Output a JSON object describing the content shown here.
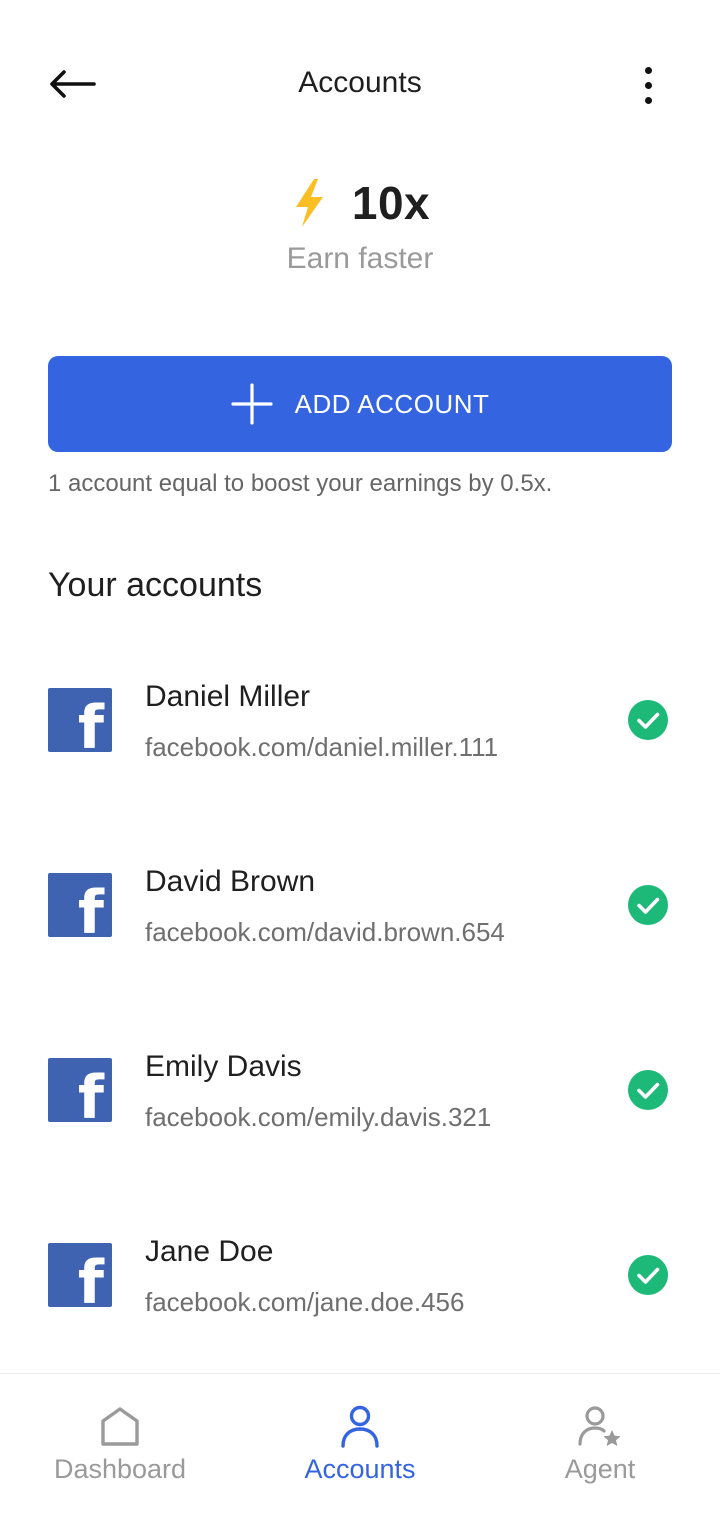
{
  "header": {
    "title": "Accounts",
    "back_icon": "arrow-left-icon",
    "menu_icon": "more-vertical-icon"
  },
  "boost": {
    "icon": "lightning-bolt-icon",
    "value": "10x",
    "subtitle": "Earn faster",
    "icon_color": "#FBBF24"
  },
  "add_account": {
    "label": "ADD ACCOUNT",
    "icon": "plus-icon",
    "color": "#3464E0"
  },
  "hint": "1 account equal to boost your earnings by 0.5x.",
  "section_title": "Your accounts",
  "accounts": [
    {
      "name": "Daniel Miller",
      "url": "facebook.com/daniel.miller.111",
      "platform_icon": "facebook-icon",
      "status_icon": "check-circle-icon"
    },
    {
      "name": "David Brown",
      "url": "facebook.com/david.brown.654",
      "platform_icon": "facebook-icon",
      "status_icon": "check-circle-icon"
    },
    {
      "name": "Emily Davis",
      "url": "facebook.com/emily.davis.321",
      "platform_icon": "facebook-icon",
      "status_icon": "check-circle-icon"
    },
    {
      "name": "Jane Doe",
      "url": "facebook.com/jane.doe.456",
      "platform_icon": "facebook-icon",
      "status_icon": "check-circle-icon"
    }
  ],
  "colors": {
    "facebook": "#3F63B0",
    "verified": "#1DB978",
    "active_nav": "#3464E0",
    "inactive_nav": "#9A9A9A"
  },
  "nav": {
    "items": [
      {
        "label": "Dashboard",
        "icon": "home-icon",
        "active": false
      },
      {
        "label": "Accounts",
        "icon": "user-icon",
        "active": true
      },
      {
        "label": "Agent",
        "icon": "user-star-icon",
        "active": false
      }
    ]
  }
}
